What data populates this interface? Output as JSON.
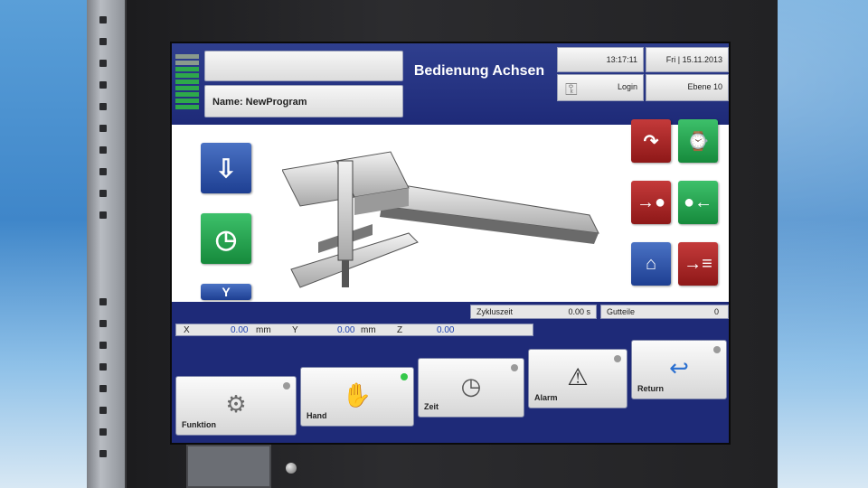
{
  "header": {
    "title": "Bedienung Achsen",
    "program_name": "Name: NewProgram",
    "time": "13:17:11",
    "date": "Fri | 15.11.2013",
    "login_label": "Login",
    "level_label": "Ebene 10"
  },
  "status": {
    "cycle_time_label": "Zykluszeit",
    "cycle_time_value": "0.00 s",
    "good_parts_label": "Gutteile",
    "good_parts_value": "0"
  },
  "coords": {
    "x_label": "X",
    "x_value": "0.00",
    "x_unit": "mm",
    "y_label": "Y",
    "y_value": "0.00",
    "y_unit": "mm",
    "z_label": "Z",
    "z_value": "0.00"
  },
  "buttons": {
    "funktion": "Funktion",
    "hand": "Hand",
    "zeit": "Zeit",
    "alarm": "Alarm",
    "return": "Return"
  },
  "icons": {
    "left_tiles": [
      "arrow-down-icon",
      "clock-icon",
      "gripper-icon"
    ],
    "right_tiles": [
      "curve-arrow-icon",
      "axis-clock-icon",
      "arrow-to-point-icon",
      "point-to-arrow-icon",
      "robot-arm-icon",
      "sequence-icon"
    ]
  },
  "colors": {
    "panel_blue": "#1e2a78",
    "tile_blue": "#1e3f92",
    "tile_green": "#168a3c",
    "tile_red": "#8e1818",
    "led_on": "#35c84a"
  }
}
